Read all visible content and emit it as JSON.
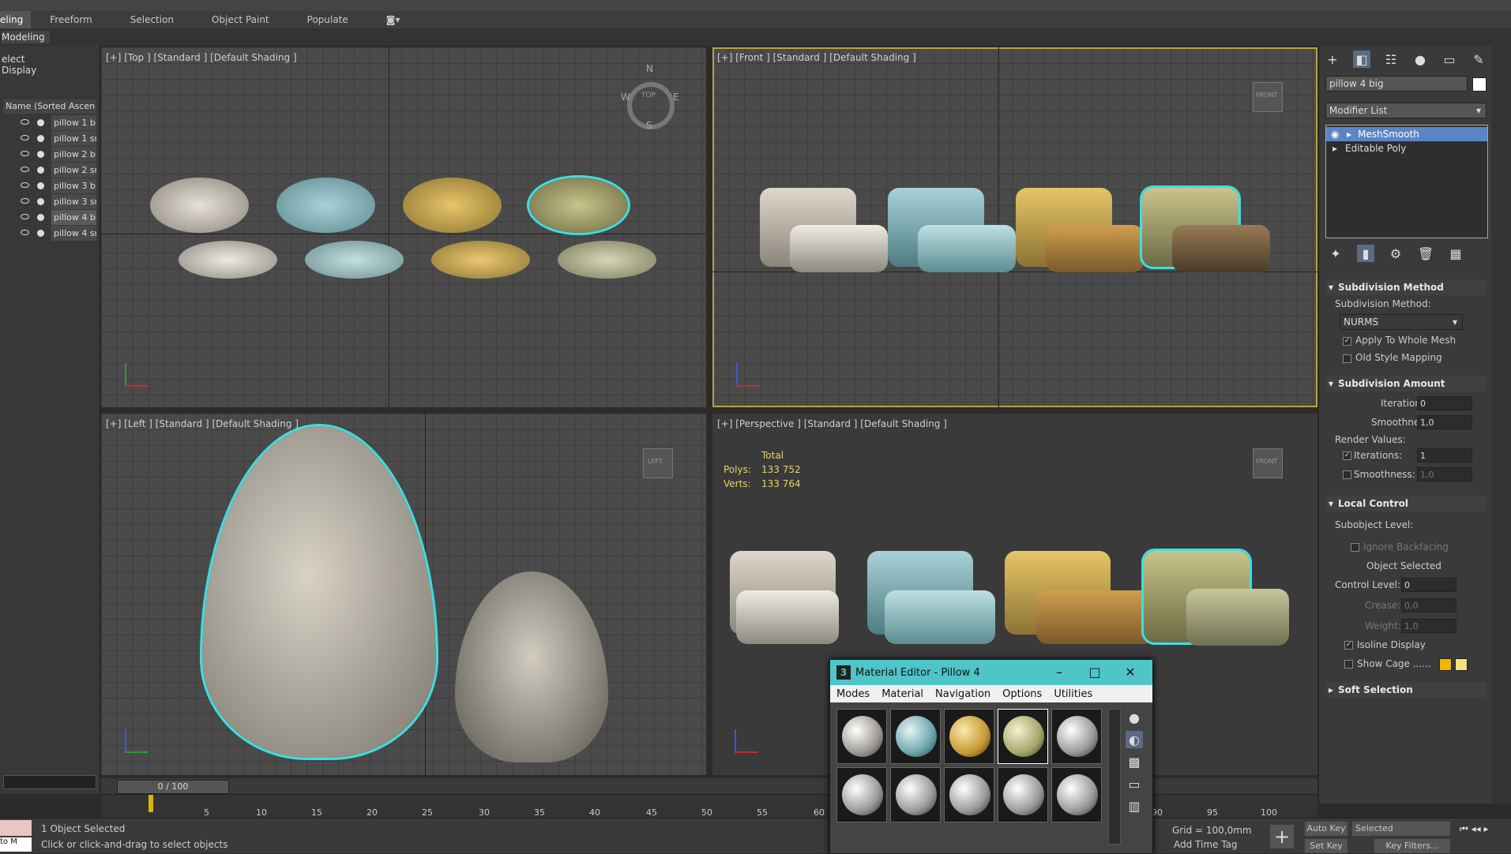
{
  "ribbon": {
    "tabs": [
      "eling",
      "Freeform",
      "Selection",
      "Object Paint",
      "Populate"
    ]
  },
  "subribbon": {
    "label": "Modeling"
  },
  "explorer": {
    "tabs": [
      "elect",
      "Display"
    ],
    "column_header": "Name (Sorted Ascen",
    "items": [
      {
        "name": "pillow 1 bi",
        "selected": false
      },
      {
        "name": "pillow 1 sm",
        "selected": false
      },
      {
        "name": "pillow 2 bi",
        "selected": false
      },
      {
        "name": "pillow 2 sn",
        "selected": false
      },
      {
        "name": "pillow 3 bi",
        "selected": false
      },
      {
        "name": "pillow 3 sn",
        "selected": false
      },
      {
        "name": "pillow 4 bi",
        "selected": true
      },
      {
        "name": "pillow 4 sn",
        "selected": false
      }
    ]
  },
  "viewports": {
    "top": {
      "title": "[+] [Top ] [Standard ] [Default Shading ]",
      "compass": {
        "n": "N",
        "s": "S",
        "e": "E",
        "w": "W",
        "cube": "TOP"
      }
    },
    "front": {
      "title": "[+] [Front ] [Standard ] [Default Shading ]",
      "cube": "FRONT"
    },
    "left": {
      "title": "[+] [Left ] [Standard ] [Default Shading ]",
      "cube": "LEFT"
    },
    "perspective": {
      "title": "[+] [Perspective ] [Standard ] [Default Shading ]",
      "cube": "FRONT",
      "stats": {
        "header": "Total",
        "polys_label": "Polys:",
        "polys": "133 752",
        "verts_label": "Verts:",
        "verts": "133 764"
      }
    }
  },
  "command_panel": {
    "object_name": "pillow 4 big",
    "modifier_list": "Modifier List",
    "stack": [
      "MeshSmooth",
      "Editable Poly"
    ],
    "subdivision_method": {
      "title": "Subdivision Method",
      "method_label": "Subdivision Method:",
      "method_value": "NURMS",
      "apply_whole_mesh": "Apply To Whole Mesh",
      "old_style": "Old Style Mapping"
    },
    "subdivision_amount": {
      "title": "Subdivision Amount",
      "iterations_label": "Iterations:",
      "iterations": "0",
      "smoothness_label": "Smoothness:",
      "smoothness": "1,0",
      "render_values": "Render Values:",
      "r_iterations_label": "Iterations:",
      "r_iterations": "1",
      "r_smoothness_label": "Smoothness:",
      "r_smoothness": "1,0"
    },
    "local_control": {
      "title": "Local Control",
      "subobject_label": "Subobject Level:",
      "ignore_backfacing": "Ignore Backfacing",
      "object_selected": "Object Selected",
      "control_level_label": "Control Level:",
      "control_level": "0",
      "crease_label": "Crease:",
      "crease": "0,0",
      "weight_label": "Weight:",
      "weight": "1,0",
      "isoline": "Isoline Display",
      "show_cage": "Show Cage ......"
    },
    "soft_selection": {
      "title": "Soft Selection"
    }
  },
  "timeline": {
    "frame": "0 / 100",
    "ticks": [
      "5",
      "10",
      "15",
      "20",
      "25",
      "30",
      "35",
      "40",
      "45",
      "50",
      "55",
      "60",
      "90",
      "95",
      "100"
    ]
  },
  "status": {
    "selected": "1 Object Selected",
    "hint": "Click or click-and-drag to select objects",
    "grid": "Grid = 100,0mm",
    "auto_key": "Auto Key",
    "set_key": "Set Key",
    "selected_dropdown": "Selected",
    "key_filters": "Key Filters...",
    "add_time_tag": "Add Time Tag",
    "script_mini": "to M"
  },
  "material_editor": {
    "badge": "3",
    "title": "Material Editor - Pillow 4",
    "menu": [
      "Modes",
      "Material",
      "Navigation",
      "Options",
      "Utilities"
    ]
  },
  "colors": {
    "accent": "#3ae0e6",
    "selection_blue": "#5b86c5",
    "dialog_title": "#4fc5c8",
    "stats_yellow": "#e5d36a"
  }
}
